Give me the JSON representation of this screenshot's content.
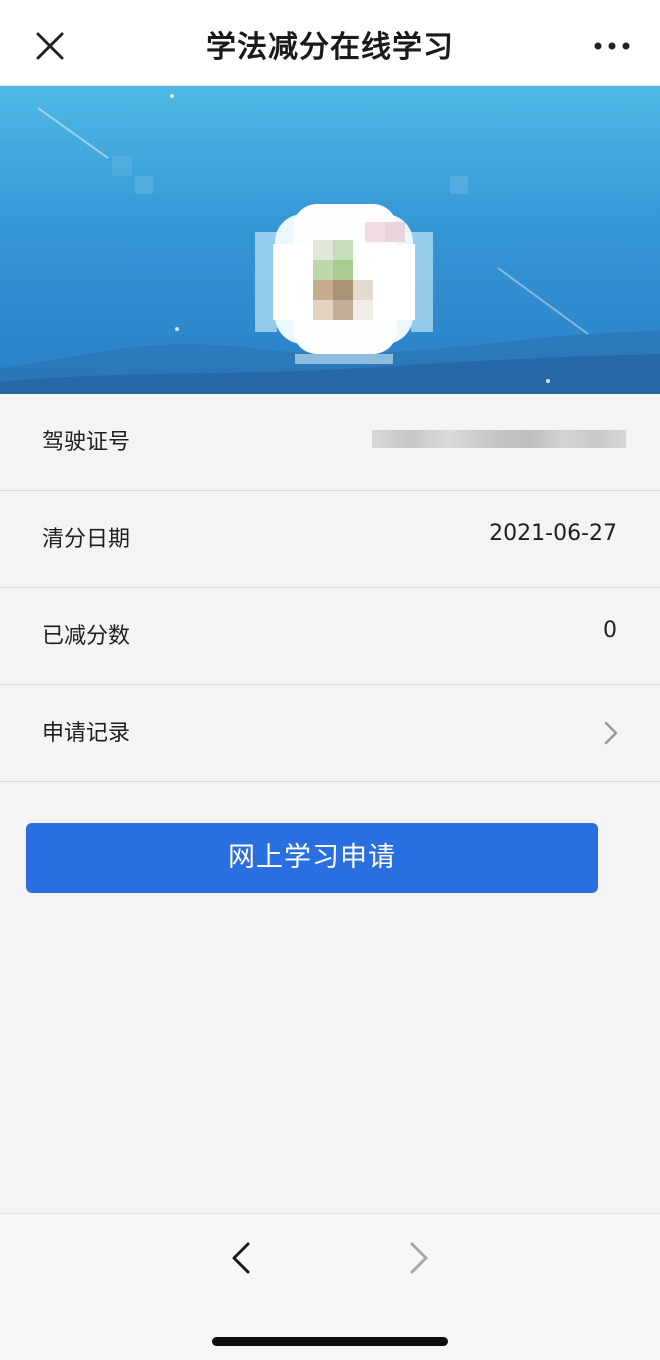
{
  "header": {
    "title": "学法减分在线学习",
    "close_icon": "close-icon",
    "more_icon": "more-horizontal-icon"
  },
  "banner": {
    "avatar_icon": "avatar-icon-pixelated"
  },
  "rows": [
    {
      "label": "驾驶证号",
      "value": ""
    },
    {
      "label": "清分日期",
      "value": "2021-06-27"
    },
    {
      "label": "已减分数",
      "value": "0"
    },
    {
      "label": "申请记录",
      "value": "",
      "icon": "chevron-right-icon"
    }
  ],
  "apply_button": {
    "label": "网上学习申请"
  },
  "bottom_nav": {
    "back_icon": "chevron-left-icon",
    "forward_icon": "chevron-right-icon"
  },
  "colors": {
    "accent": "#2a6fdf",
    "banner_top": "#4fb8e4",
    "banner_bottom": "#2a7fc6",
    "background": "#f4f4f4"
  }
}
